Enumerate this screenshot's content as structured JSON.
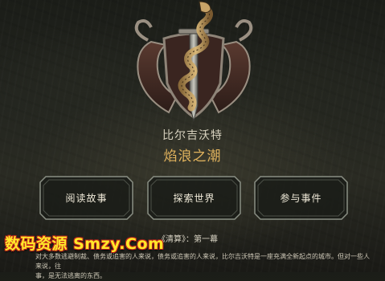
{
  "header": {
    "subtitle": "比尔吉沃特",
    "title": "焰浪之潮"
  },
  "menu": {
    "buttons": [
      {
        "label": "阅读故事"
      },
      {
        "label": "探索世界"
      },
      {
        "label": "参与事件"
      }
    ]
  },
  "footer": {
    "watermark": "数码资源 Smzy.Com",
    "chapter": "《清算》：第一幕",
    "story_line1": "对大多数逃避制裁、债务或追害的人来说，债务或追害的人来说，比尔吉沃特是一座充满全新起点的城市。但对一些人来说，往",
    "story_line2": "事，是无法逃离的东西。"
  },
  "colors": {
    "title_gold": "#e0b25d",
    "button_border": "#8a8f84",
    "watermark_yellow": "#ffe82a",
    "watermark_outline": "#c0261b"
  },
  "icons": {
    "emblem": "serpent-sword-crest-icon"
  }
}
